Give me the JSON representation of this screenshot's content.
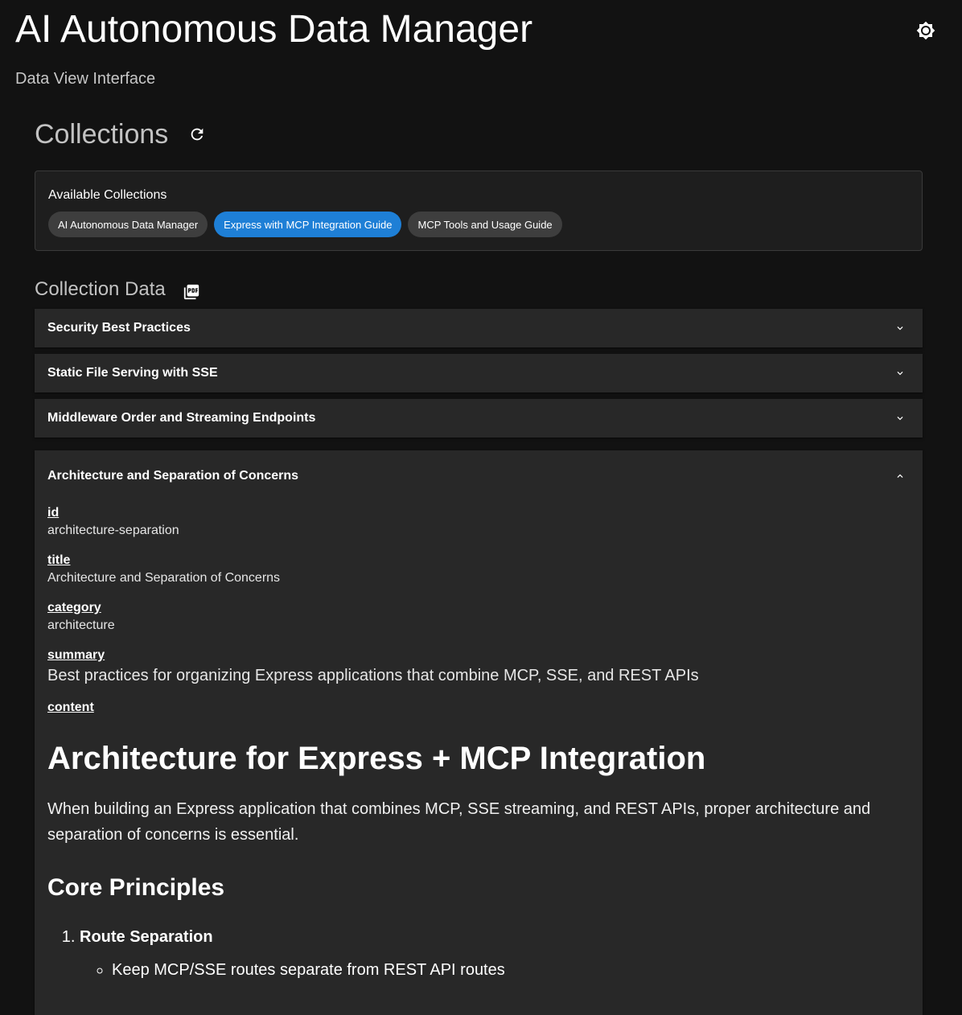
{
  "app": {
    "title": "AI Autonomous Data Manager",
    "subtitle": "Data View Interface",
    "theme_icon": "brightness-icon"
  },
  "collections": {
    "heading": "Collections",
    "refresh_icon": "refresh-icon",
    "card_label": "Available Collections",
    "chips": [
      {
        "label": "AI Autonomous Data Manager",
        "selected": false
      },
      {
        "label": "Express with MCP Integration Guide",
        "selected": true
      },
      {
        "label": "MCP Tools and Usage Guide",
        "selected": false
      }
    ]
  },
  "collection_data": {
    "heading": "Collection Data",
    "pdf_icon": "pdf-icon",
    "items": [
      {
        "title": "Security Best Practices",
        "expanded": false
      },
      {
        "title": "Static File Serving with SSE",
        "expanded": false
      },
      {
        "title": "Middleware Order and Streaming Endpoints",
        "expanded": false
      },
      {
        "title": "Architecture and Separation of Concerns",
        "expanded": true
      }
    ],
    "expanded": {
      "fields": {
        "id_label": "id",
        "id_value": "architecture-separation",
        "title_label": "title",
        "title_value": "Architecture and Separation of Concerns",
        "category_label": "category",
        "category_value": "architecture",
        "summary_label": "summary",
        "summary_value": "Best practices for organizing Express applications that combine MCP, SSE, and REST APIs",
        "content_label": "content"
      },
      "content": {
        "h1": "Architecture for Express + MCP Integration",
        "intro": "When building an Express application that combines MCP, SSE streaming, and REST APIs, proper architecture and separation of concerns is essential.",
        "h2": "Core Principles",
        "list_item_1": "Route Separation",
        "sub_item_1": "Keep MCP/SSE routes separate from REST API routes"
      }
    }
  },
  "colors": {
    "background": "#121212",
    "card": "#1e1e1e",
    "accordion": "#282828",
    "accent": "#1e7fd6"
  }
}
